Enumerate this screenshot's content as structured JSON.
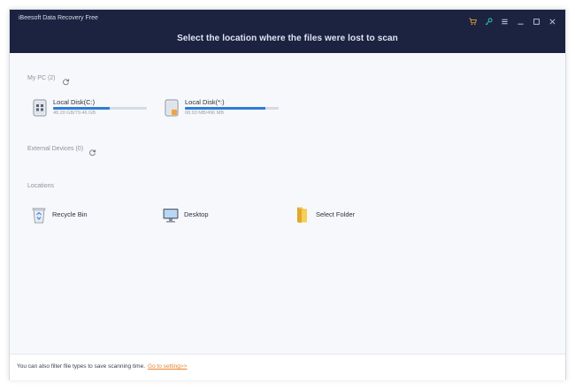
{
  "app": {
    "title": "iBeesoft Data Recovery Free",
    "heading": "Select the location where the files were lost to scan"
  },
  "window_controls": [
    "cart-icon",
    "key-icon",
    "menu-icon",
    "minimize-icon",
    "maximize-icon",
    "close-icon"
  ],
  "my_pc": {
    "label": "My PC (2)",
    "drives": [
      {
        "name": "Local Disk(C:)",
        "size": "48.20 GB/79.46 GB",
        "usage": 0.6
      },
      {
        "name": "Local Disk(*:)",
        "size": "68.93 MB/496 MB",
        "usage": 0.86
      }
    ]
  },
  "external": {
    "label": "External Devices (0)"
  },
  "locations": {
    "label": "Locations",
    "items": [
      {
        "name": "Recycle Bin",
        "icon": "recycle-bin-icon"
      },
      {
        "name": "Desktop",
        "icon": "desktop-icon"
      },
      {
        "name": "Select Folder",
        "icon": "folder-icon"
      }
    ]
  },
  "footer": {
    "text": "You can also filter file types to save scanning time.",
    "link": "Go to setting>>"
  },
  "colors": {
    "titlebar": "#1c2340",
    "accent": "#2f7dd6",
    "link": "#e8822a",
    "cart": "#e8a036",
    "key": "#32c8b4"
  }
}
